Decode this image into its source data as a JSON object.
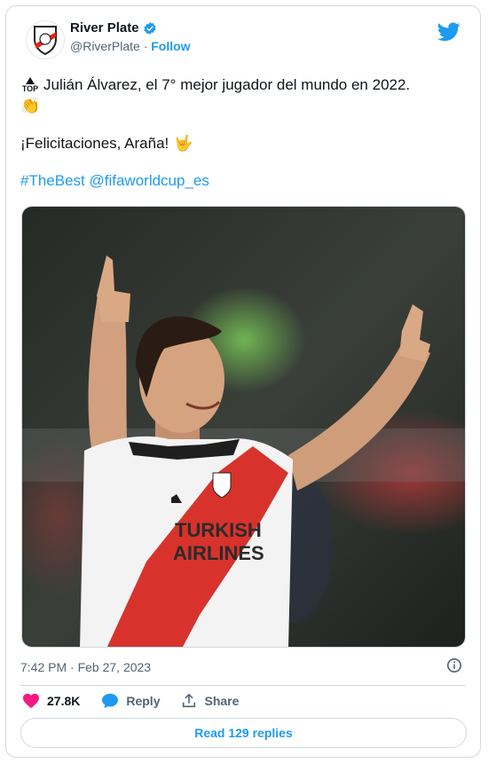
{
  "author": {
    "display_name": "River Plate",
    "handle": "@RiverPlate",
    "follow_label": "Follow",
    "verified_icon": "verified-badge-icon",
    "brand_icon": "twitter-bird-icon"
  },
  "tweet": {
    "line1_text": "Julián Álvarez, el 7° mejor jugador del mundo en 2022.",
    "line1_emoji_top": "TOP",
    "line1_emoji_clap": "👏",
    "line2_text": "¡Felicitaciones, Araña!",
    "line2_emoji": "🤟",
    "hashtag": "#TheBest",
    "mention": "@fifaworldcup_es"
  },
  "media": {
    "jersey_text_1": "TURKISH",
    "jersey_text_2": "AIRLINES"
  },
  "meta": {
    "timestamp": "7:42 PM · Feb 27, 2023"
  },
  "actions": {
    "likes_count": "27.8K",
    "reply_label": "Reply",
    "share_label": "Share"
  },
  "read_replies_label": "Read 129 replies",
  "colors": {
    "accent": "#1d9bf0",
    "like": "#f91880",
    "muted": "#536471",
    "border": "#cfd9de"
  }
}
